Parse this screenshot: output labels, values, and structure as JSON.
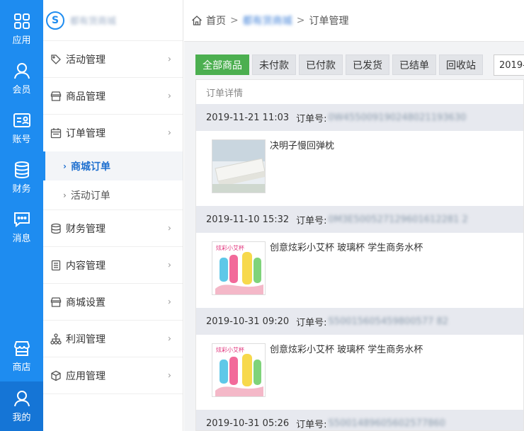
{
  "rail": {
    "items": [
      {
        "label": "应用",
        "icon": "apps-grid-icon"
      },
      {
        "label": "会员",
        "icon": "user-icon"
      },
      {
        "label": "账号",
        "icon": "account-card-icon"
      },
      {
        "label": "财务",
        "icon": "database-icon"
      },
      {
        "label": "消息",
        "icon": "message-icon"
      },
      {
        "label": "商店",
        "icon": "store-icon"
      },
      {
        "label": "我的",
        "icon": "user-icon"
      }
    ]
  },
  "sidebar": {
    "logo_text": "都有货商城",
    "groups": [
      {
        "label": "活动管理",
        "icon": "tag-icon"
      },
      {
        "label": "商品管理",
        "icon": "store-icon"
      },
      {
        "label": "订单管理",
        "icon": "calendar-icon"
      },
      {
        "label": "财务管理",
        "icon": "coins-icon"
      },
      {
        "label": "内容管理",
        "icon": "document-icon"
      },
      {
        "label": "商城设置",
        "icon": "store-icon"
      },
      {
        "label": "利润管理",
        "icon": "org-chart-icon"
      },
      {
        "label": "应用管理",
        "icon": "cube-icon"
      }
    ],
    "order_sub": [
      {
        "label": "商城订单"
      },
      {
        "label": "活动订单"
      }
    ]
  },
  "breadcrumb": {
    "home": "首页",
    "shop": "都有货商城",
    "current": "订单管理"
  },
  "tabs": [
    "全部商品",
    "未付款",
    "已付款",
    "已发货",
    "已结单",
    "回收站"
  ],
  "date_value": "2019-",
  "panel": {
    "title": "订单详情",
    "order_no_label": "订单号:",
    "orders": [
      {
        "time": "2019-11-21 11:03",
        "no": "0W455009190248021193630",
        "product": "决明子慢回弹枕"
      },
      {
        "time": "2019-11-10 15:32",
        "no": "0M3E500527129601612281 2",
        "product": "创意炫彩小艾杯 玻璃杯 学生商务水杯"
      },
      {
        "time": "2019-10-31 09:20",
        "no": "S50015605459800577 82",
        "product": "创意炫彩小艾杯 玻璃杯 学生商务水杯"
      },
      {
        "time": "2019-10-31 05:26",
        "no": "S5001489605602577860",
        "product": ""
      }
    ]
  },
  "colors": {
    "rail": "#1e8cf0",
    "rail_active": "#1575d6",
    "tab_active": "#4caf50",
    "link": "#1e6fcf"
  }
}
